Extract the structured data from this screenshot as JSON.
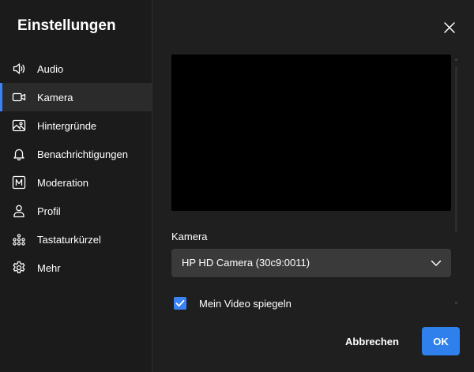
{
  "dialog": {
    "title": "Einstellungen",
    "close_icon": "close-icon"
  },
  "sidebar": {
    "items": [
      {
        "label": "Audio",
        "icon": "speaker-icon",
        "active": false
      },
      {
        "label": "Kamera",
        "icon": "video-camera-icon",
        "active": true
      },
      {
        "label": "Hintergründe",
        "icon": "image-icon",
        "active": false
      },
      {
        "label": "Benachrichtigungen",
        "icon": "bell-icon",
        "active": false
      },
      {
        "label": "Moderation",
        "icon": "moderator-icon",
        "active": false
      },
      {
        "label": "Profil",
        "icon": "user-icon",
        "active": false
      },
      {
        "label": "Tastaturkürzel",
        "icon": "shortcuts-icon",
        "active": false
      },
      {
        "label": "Mehr",
        "icon": "gear-icon",
        "active": false
      }
    ]
  },
  "camera": {
    "field_label": "Kamera",
    "selected_device": "HP HD Camera (30c9:0011)",
    "mirror_label": "Mein Video spiegeln",
    "mirror_checked": true
  },
  "footer": {
    "cancel_label": "Abbrechen",
    "ok_label": "OK"
  },
  "colors": {
    "accent": "#2f80ed",
    "background": "#1f1f1f",
    "sidebar": "#1b1b1b",
    "active_item": "#2b2b2b",
    "select": "#3a3a3a"
  }
}
